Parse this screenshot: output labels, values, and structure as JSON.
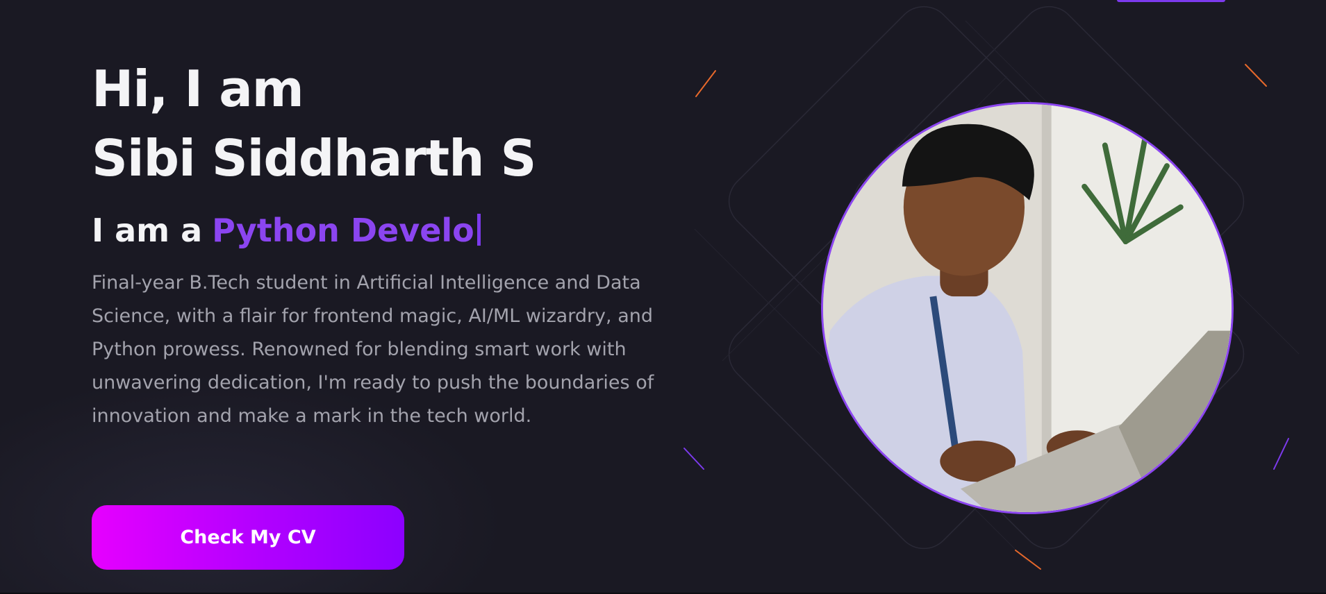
{
  "hero": {
    "greeting": "Hi, I am",
    "name": "Sibi Siddharth S",
    "role_prefix": "I am a",
    "role_typed": "Python Develo",
    "bio": "Final-year B.Tech student in Artificial Intelligence and Data Science, with a flair for frontend magic, AI/ML wizardry, and Python prowess. Renowned for blending smart work with unwavering dedication, I'm ready to push the boundaries of innovation and make a mark in the tech world.",
    "cta_label": "Check My CV"
  },
  "photo": {
    "icon": "profile-photo-icon"
  },
  "colors": {
    "background": "#1a1923",
    "accent": "#8b45f0",
    "cta_gradient_start": "#e600ff",
    "cta_gradient_end": "#8c00ff"
  }
}
